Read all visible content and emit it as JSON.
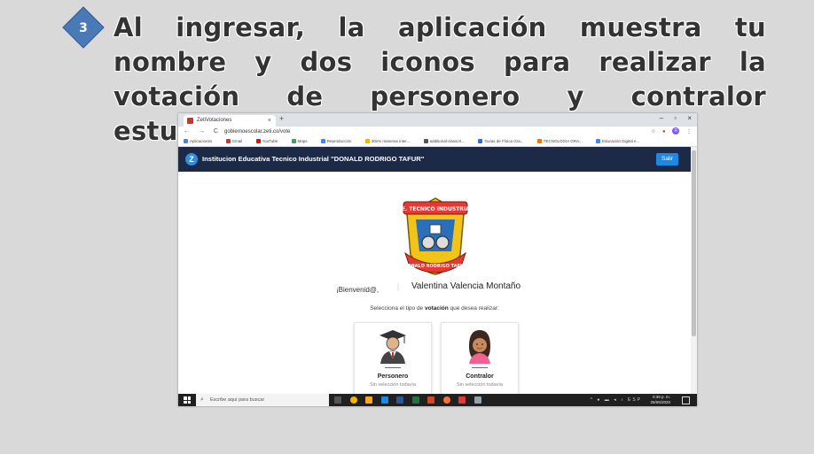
{
  "slide": {
    "step_number": "3",
    "text": "Al ingresar, la aplicación muestra tu nombre y dos iconos para realizar la votación de personero y contralor estudiantil."
  },
  "browser": {
    "tab_title": "ZetiVotaciones",
    "tab_close": "×",
    "new_tab": "+",
    "window_controls": [
      "–",
      "▫",
      "×"
    ],
    "nav_icons": "← → C",
    "url": "gobiernoescolar.zeti.co/vote",
    "profile_initial": "R",
    "bookmarks": [
      {
        "label": "Aplicaciones",
        "color": "#4285f4"
      },
      {
        "label": "Gmail",
        "color": "#d93025"
      },
      {
        "label": "YouTube",
        "color": "#ff0000"
      },
      {
        "label": "Maps",
        "color": "#34a853"
      },
      {
        "label": "Reproducción",
        "color": "#4285f4"
      },
      {
        "label": "30x% maneras inter...",
        "color": "#f4b400"
      },
      {
        "label": "additional:classcrt...",
        "color": "#555555"
      },
      {
        "label": "Guías de Física Gra...",
        "color": "#1a73e8"
      },
      {
        "label": "TECNOLOGIA GRA...",
        "color": "#ff6d00"
      },
      {
        "label": "Educación Digital e...",
        "color": "#4285f4"
      }
    ]
  },
  "app": {
    "logo_letter": "Z",
    "school_name": "Institucion Educativa Tecnico Industrial \"DONALD RODRIGO TAFUR\"",
    "logout_label": "Salir",
    "crest": {
      "top_text": "I.E. TECNICO INDUSTRIAL",
      "bottom_text": "DONALD RODRIGO TAFUR"
    },
    "welcome": "¡Bienvenid@,",
    "user_name": "Valentina Valencia Montaño",
    "instruction_before": "Selecciona el tipo de ",
    "instruction_bold": "votación",
    "instruction_after": " que desea realizar:",
    "options": [
      {
        "title": "Personero",
        "status": "Sin selección todavía",
        "icon": "graduate-icon"
      },
      {
        "title": "Contralor",
        "status": "Sin selección todavía",
        "icon": "student-girl-icon"
      }
    ]
  },
  "taskbar": {
    "search_placeholder": "Escribe aquí para buscar",
    "time": "0:39 p. m.",
    "date": "25/06/2020",
    "lang": "ESP"
  }
}
